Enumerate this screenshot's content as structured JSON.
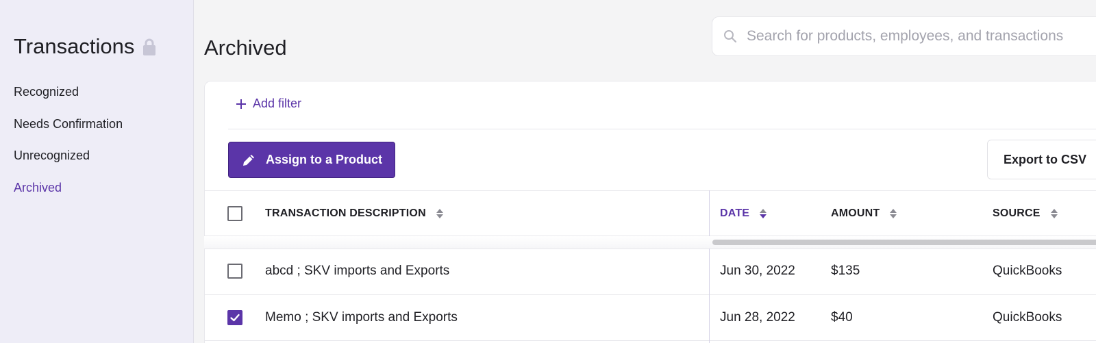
{
  "sidebar": {
    "title": "Transactions",
    "items": [
      {
        "label": "Recognized"
      },
      {
        "label": "Needs Confirmation"
      },
      {
        "label": "Unrecognized"
      },
      {
        "label": "Archived"
      }
    ],
    "active": "Archived"
  },
  "page": {
    "title": "Archived"
  },
  "search": {
    "placeholder": "Search for products, employees, and transactions"
  },
  "toolbar": {
    "add_filter_label": "Add filter",
    "assign_label": "Assign to a Product",
    "export_label": "Export to CSV"
  },
  "table": {
    "columns": [
      {
        "label": "TRANSACTION DESCRIPTION"
      },
      {
        "label": "DATE"
      },
      {
        "label": "AMOUNT"
      },
      {
        "label": "SOURCE"
      }
    ],
    "sorted_column": "DATE",
    "rows": [
      {
        "description": "abcd ; SKV imports and Exports",
        "date": "Jun 30, 2022",
        "amount": "$135",
        "source": "QuickBooks",
        "checked": false
      },
      {
        "description": "Memo ; SKV imports and Exports",
        "date": "Jun 28, 2022",
        "amount": "$40",
        "source": "QuickBooks",
        "checked": true
      }
    ]
  },
  "colors": {
    "accent": "#5b35a8",
    "sidebar_bg": "#eeedf7",
    "page_bg": "#f4f4f5"
  },
  "icons": {
    "title": "lock-icon",
    "search": "search-icon",
    "add_filter": "plus-icon",
    "assign": "pencil-icon",
    "sort": "sort-icon",
    "checkbox_checked": "checkmark-icon"
  }
}
